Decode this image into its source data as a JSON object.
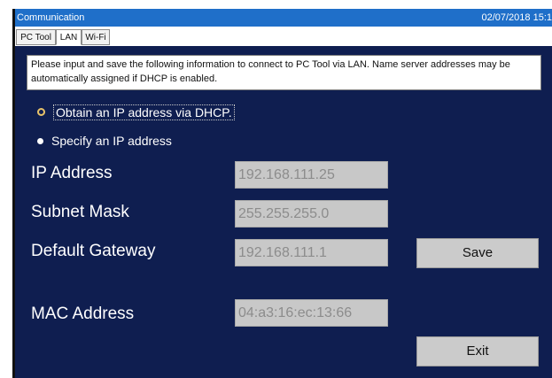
{
  "window": {
    "title": "Communication",
    "datetime": "02/07/2018 15:1"
  },
  "tabs": [
    {
      "label": "PC Tool",
      "active": false
    },
    {
      "label": "LAN",
      "active": true
    },
    {
      "label": "Wi-Fi",
      "active": false
    }
  ],
  "notice": "Please input and save the following information to connect to PC Tool via LAN. Name server addresses may be automatically assigned if DHCP is enabled.",
  "options": {
    "dhcp_label": "Obtain an IP address via DHCP.",
    "specify_label": "Specify an IP address"
  },
  "fields": {
    "ip_label": "IP Address",
    "ip_value": "192.168.111.25",
    "subnet_label": "Subnet Mask",
    "subnet_value": "255.255.255.0",
    "gateway_label": "Default Gateway",
    "gateway_value": "192.168.111.1",
    "mac_label": "MAC Address",
    "mac_value": "04:a3:16:ec:13:66"
  },
  "buttons": {
    "save": "Save",
    "exit": "Exit"
  },
  "colors": {
    "titlebar": "#1f6fc9",
    "panel": "#0f1e50",
    "field": "#c8c8c8",
    "button": "#cbcbcb"
  }
}
